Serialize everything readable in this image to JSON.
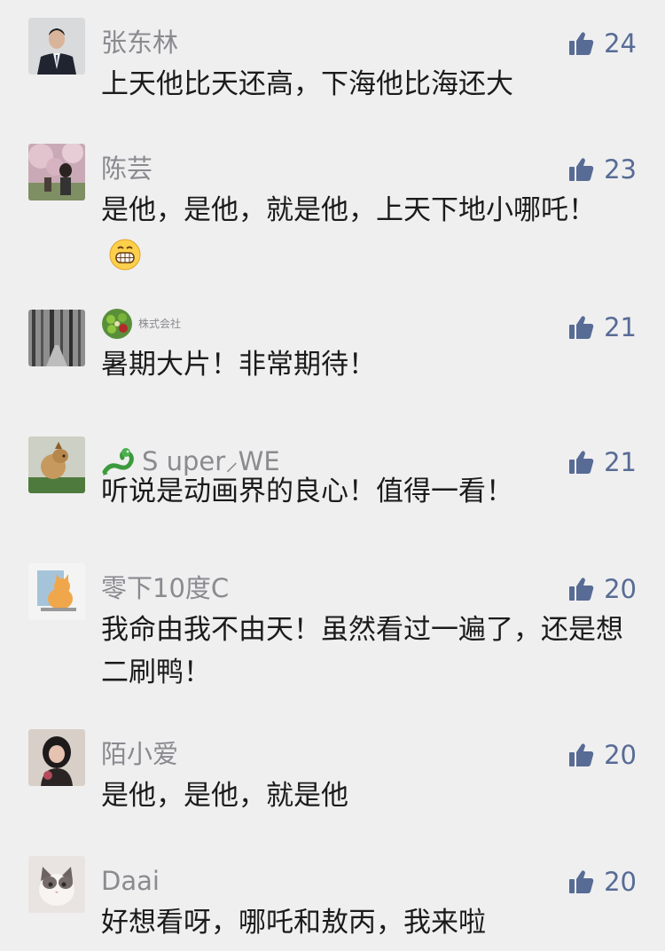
{
  "comments": [
    {
      "name": "张东林",
      "text": "上天他比天还高，下海他比海还大",
      "likes": "24",
      "avatar_icon": "man-in-suit-avatar"
    },
    {
      "name": "陈芸",
      "text": "是他，是他，就是他，上天下地小哪吒！",
      "likes": "23",
      "avatar_icon": "woman-blossom-avatar",
      "emoji": "grinning-face-emoji"
    },
    {
      "name": "株式会社",
      "text": "暑期大片！非常期待！",
      "likes": "21",
      "avatar_icon": "forest-avatar",
      "name_icon": "company-logo-icon"
    },
    {
      "name": "S uper⸝WE",
      "text": "听说是动画界的良心！值得一看！",
      "likes": "21",
      "avatar_icon": "dog-avatar",
      "name_icon": "dragon-icon"
    },
    {
      "name": "零下10度C",
      "text": "我命由我不由天！虽然看过一遍了，还是想二刷鸭！",
      "likes": "20",
      "avatar_icon": "cat-cartoon-avatar"
    },
    {
      "name": "陌小爱",
      "text": "是他，是他，就是他",
      "likes": "20",
      "avatar_icon": "girl-avatar"
    },
    {
      "name": "Daai",
      "text": "好想看呀，哪吒和敖丙，我来啦",
      "likes": "20",
      "avatar_icon": "kitten-avatar"
    }
  ],
  "colors": {
    "background": "#efeff0",
    "name": "#8a8a8f",
    "text": "#1b1b1b",
    "like": "#576b95"
  }
}
